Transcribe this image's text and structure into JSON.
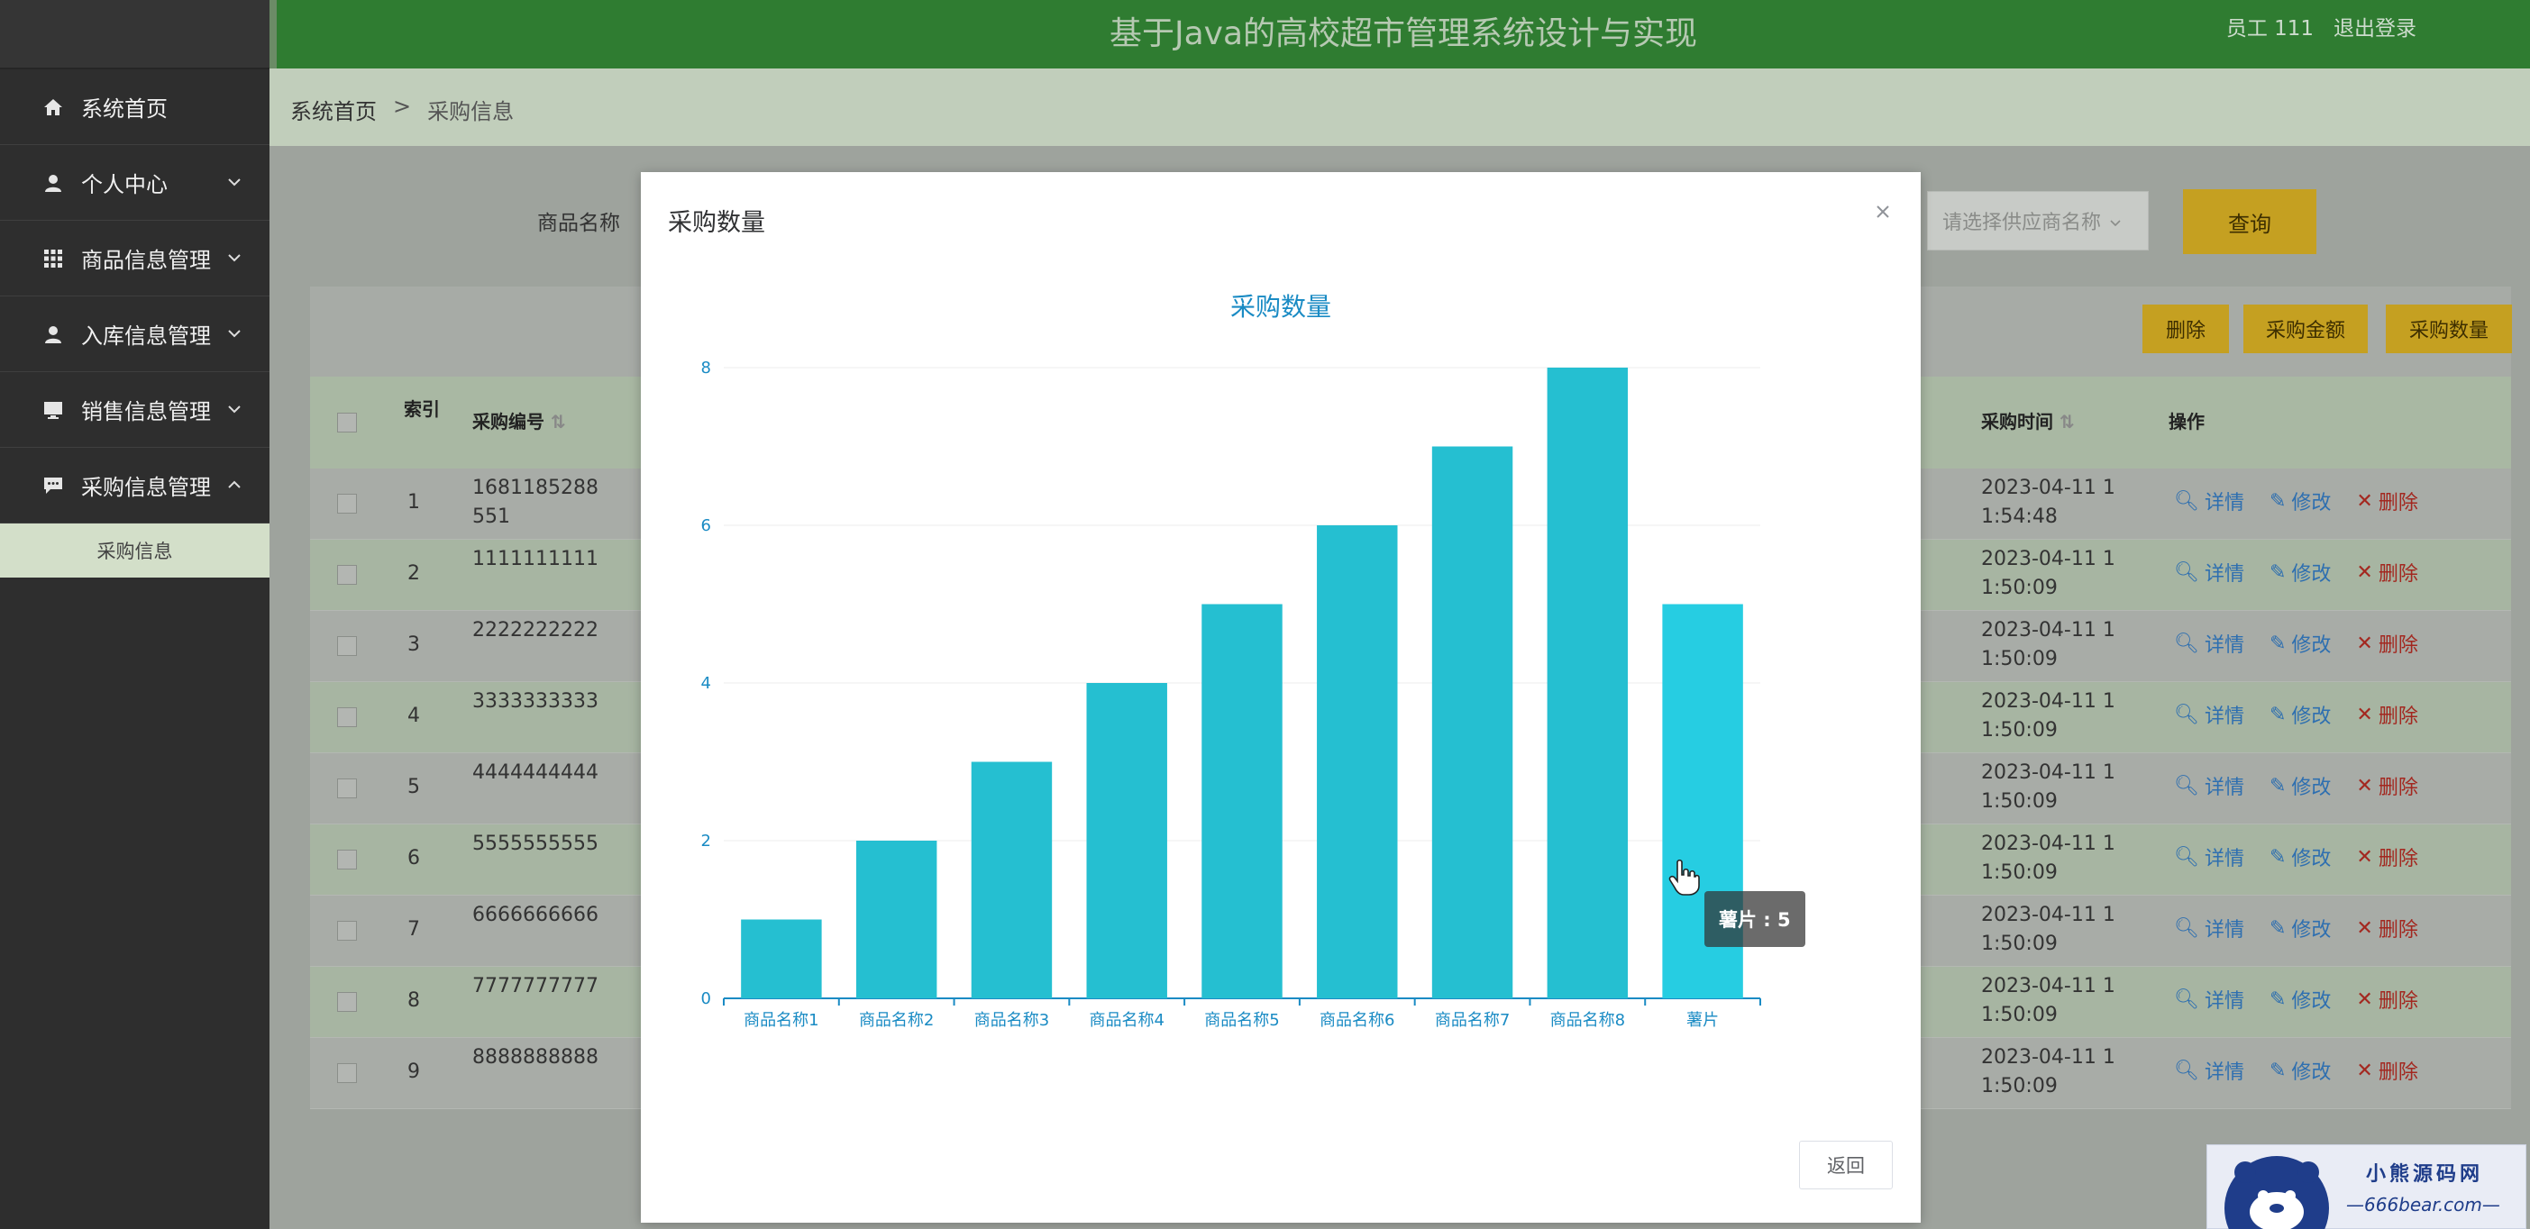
{
  "app": {
    "title": "基于Java的高校超市管理系统设计与实现",
    "user": "员工 111",
    "logout": "退出登录"
  },
  "sidebar": {
    "items": [
      {
        "label": "系统首页",
        "icon": "home-icon"
      },
      {
        "label": "个人中心",
        "icon": "user-icon"
      },
      {
        "label": "商品信息管理",
        "icon": "grid-icon"
      },
      {
        "label": "入库信息管理",
        "icon": "user-icon"
      },
      {
        "label": "销售信息管理",
        "icon": "monitor-icon"
      },
      {
        "label": "采购信息管理",
        "icon": "chat-icon"
      }
    ],
    "sub_item": "采购信息"
  },
  "breadcrumb": {
    "home": "系统首页",
    "sep": ">",
    "current": "采购信息"
  },
  "search": {
    "label": "商品名称",
    "supplier_placeholder": "请选择供应商名称",
    "query": "查询"
  },
  "actions": {
    "delete": "删除",
    "amount": "采购金额",
    "quantity": "采购数量"
  },
  "table": {
    "headers": {
      "index": "索引",
      "code": "采购编号",
      "time": "采购时间",
      "ops": "操作"
    },
    "ops": {
      "detail": "详情",
      "edit": "修改",
      "delete": "删除"
    },
    "rows": [
      {
        "index": "1",
        "code": "1681185288551",
        "time": "2023-04-11 11:54:48"
      },
      {
        "index": "2",
        "code": "1111111111",
        "time": "2023-04-11 11:50:09"
      },
      {
        "index": "3",
        "code": "2222222222",
        "time": "2023-04-11 11:50:09"
      },
      {
        "index": "4",
        "code": "3333333333",
        "time": "2023-04-11 11:50:09"
      },
      {
        "index": "5",
        "code": "4444444444",
        "time": "2023-04-11 11:50:09"
      },
      {
        "index": "6",
        "code": "5555555555",
        "time": "2023-04-11 11:50:09"
      },
      {
        "index": "7",
        "code": "6666666666",
        "time": "2023-04-11 11:50:09"
      },
      {
        "index": "8",
        "code": "7777777777",
        "time": "2023-04-11 11:50:09"
      },
      {
        "index": "9",
        "code": "8888888888",
        "time": "2023-04-11 11:50:09"
      }
    ]
  },
  "modal": {
    "title": "采购数量",
    "back": "返回",
    "tooltip": "薯片 : 5"
  },
  "watermark": {
    "cn": "小熊源码网",
    "url": "—666bear.com—"
  },
  "colors": {
    "bar": "#25bfd1",
    "bar_highlight": "#26cde2",
    "axis": "#1a8bc4",
    "brand_green": "#2f7c31",
    "button_gold": "#f0c12a"
  },
  "chart_data": {
    "type": "bar",
    "title": "采购数量",
    "categories": [
      "商品名称1",
      "商品名称2",
      "商品名称3",
      "商品名称4",
      "商品名称5",
      "商品名称6",
      "商品名称7",
      "商品名称8",
      "薯片"
    ],
    "values": [
      1,
      2,
      3,
      4,
      5,
      6,
      7,
      8,
      5
    ],
    "ylim": [
      0,
      8
    ],
    "yticks": [
      0,
      2,
      4,
      6,
      8
    ],
    "xlabel": "",
    "ylabel": "",
    "grid": true,
    "highlighted_index": 8
  }
}
